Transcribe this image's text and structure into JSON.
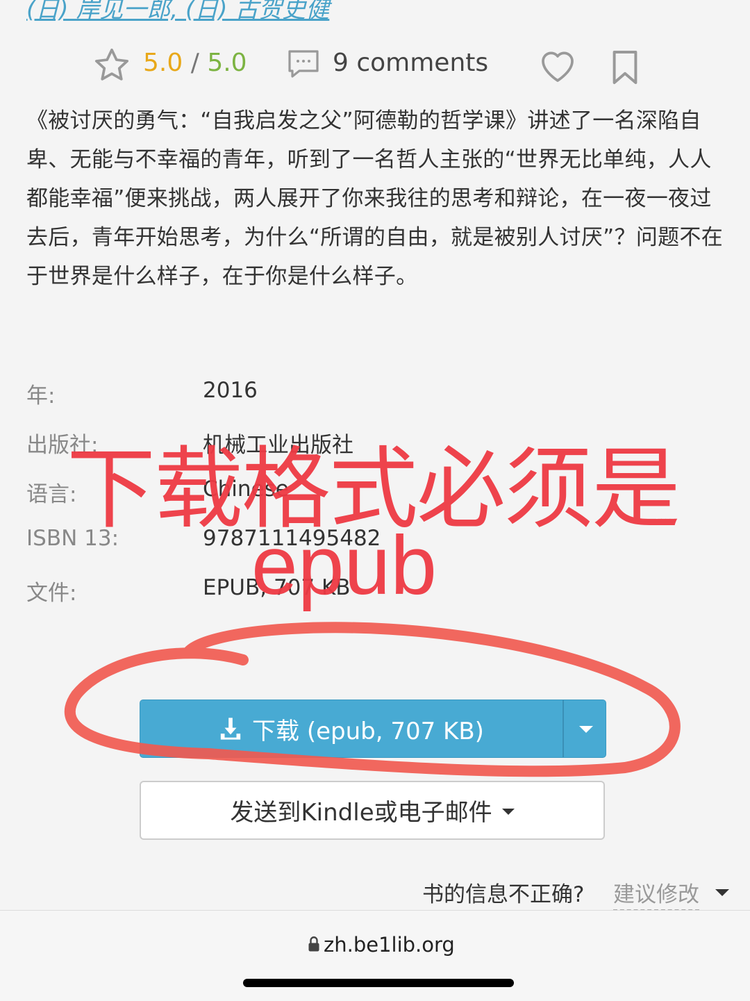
{
  "authors": "(日) 岸见一郎, (日) 古贺史健",
  "rating": {
    "value": "5.0",
    "separator": "/",
    "max": "5.0"
  },
  "comments_label": "9 comments",
  "description": "《被讨厌的勇气：“自我启发之父”阿德勒的哲学课》讲述了一名深陷自卑、无能与不幸福的青年，听到了一名哲人主张的“世界无比单纯，人人都能幸福”便来挑战，两人展开了你来我往的思考和辩论，在一夜一夜过去后，青年开始思考，为什么“所谓的自由，就是被别人讨厌”？问题不在于世界是什么样子，在于你是什么样子。",
  "details": [
    {
      "label": "年:",
      "value": "2016"
    },
    {
      "label": "出版社:",
      "value": "机械工业出版社"
    },
    {
      "label": "语言:",
      "value": "Chinese"
    },
    {
      "label": "ISBN 13:",
      "value": "9787111495482"
    },
    {
      "label": "文件:",
      "value": "EPUB, 707 KB"
    }
  ],
  "download_button": "下载 (epub, 707 KB)",
  "send_button": "发送到Kindle或电子邮件",
  "incorrect_info": "书的信息不正确?",
  "suggest_edit": "建议修改",
  "url": "zh.be1lib.org",
  "annotation": {
    "line1": "下载格式必须是",
    "line2": "epub",
    "color": "#ee3a44"
  },
  "colors": {
    "accent": "#48aad3",
    "rating_gold": "#e8a81a",
    "rating_green": "#7cb342"
  }
}
